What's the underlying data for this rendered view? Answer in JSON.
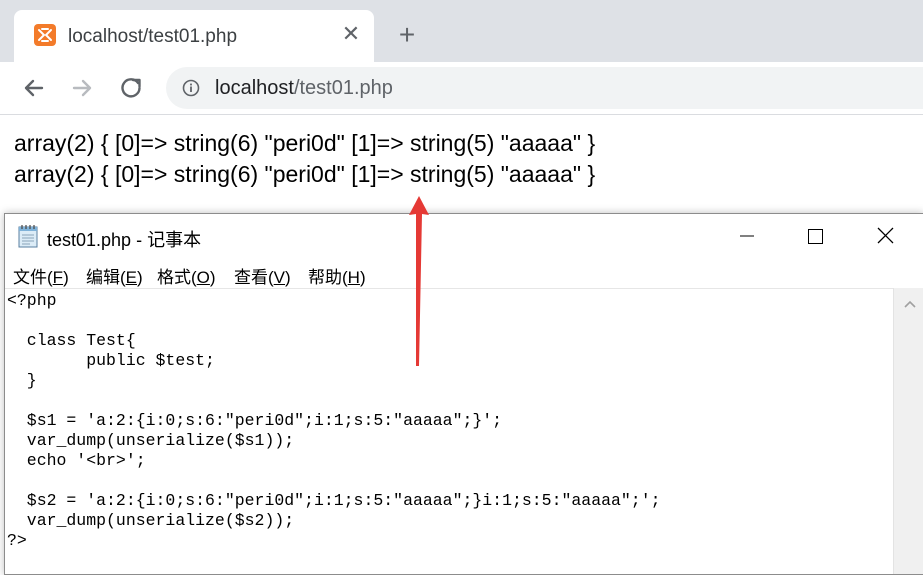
{
  "browser": {
    "tab_title": "localhost/test01.php",
    "close_glyph": "✕",
    "newtab_glyph": "+",
    "url_host": "localhost",
    "url_path": "/test01.php",
    "favicon": "xampp-icon",
    "favicon_color": "#f37b2a"
  },
  "page": {
    "lines": [
      "array(2) { [0]=> string(6) \"peri0d\" [1]=> string(5) \"aaaaa\" }",
      "array(2) { [0]=> string(6) \"peri0d\" [1]=> string(5) \"aaaaa\" }"
    ]
  },
  "notepad": {
    "title": "test01.php - 记事本",
    "menu": [
      {
        "label": "文件(",
        "accel": "F",
        "end": ")"
      },
      {
        "label": "编辑(",
        "accel": "E",
        "end": ")"
      },
      {
        "label": "格式(",
        "accel": "O",
        "end": ")"
      },
      {
        "label": "查看(",
        "accel": "V",
        "end": ")"
      },
      {
        "label": "帮助(",
        "accel": "H",
        "end": ")"
      }
    ],
    "code": [
      "<?php",
      "",
      "  class Test{",
      "        public $test;",
      "  }",
      "",
      "  $s1 = 'a:2:{i:0;s:6:\"peri0d\";i:1;s:5:\"aaaaa\";}';",
      "  var_dump(unserialize($s1));",
      "  echo '<br>';",
      "",
      "  $s2 = 'a:2:{i:0;s:6:\"peri0d\";i:1;s:5:\"aaaaa\";}i:1;s:5:\"aaaaa\";';",
      "  var_dump(unserialize($s2));",
      "?>"
    ]
  },
  "annotation": {
    "arrow_color": "#e53935"
  }
}
